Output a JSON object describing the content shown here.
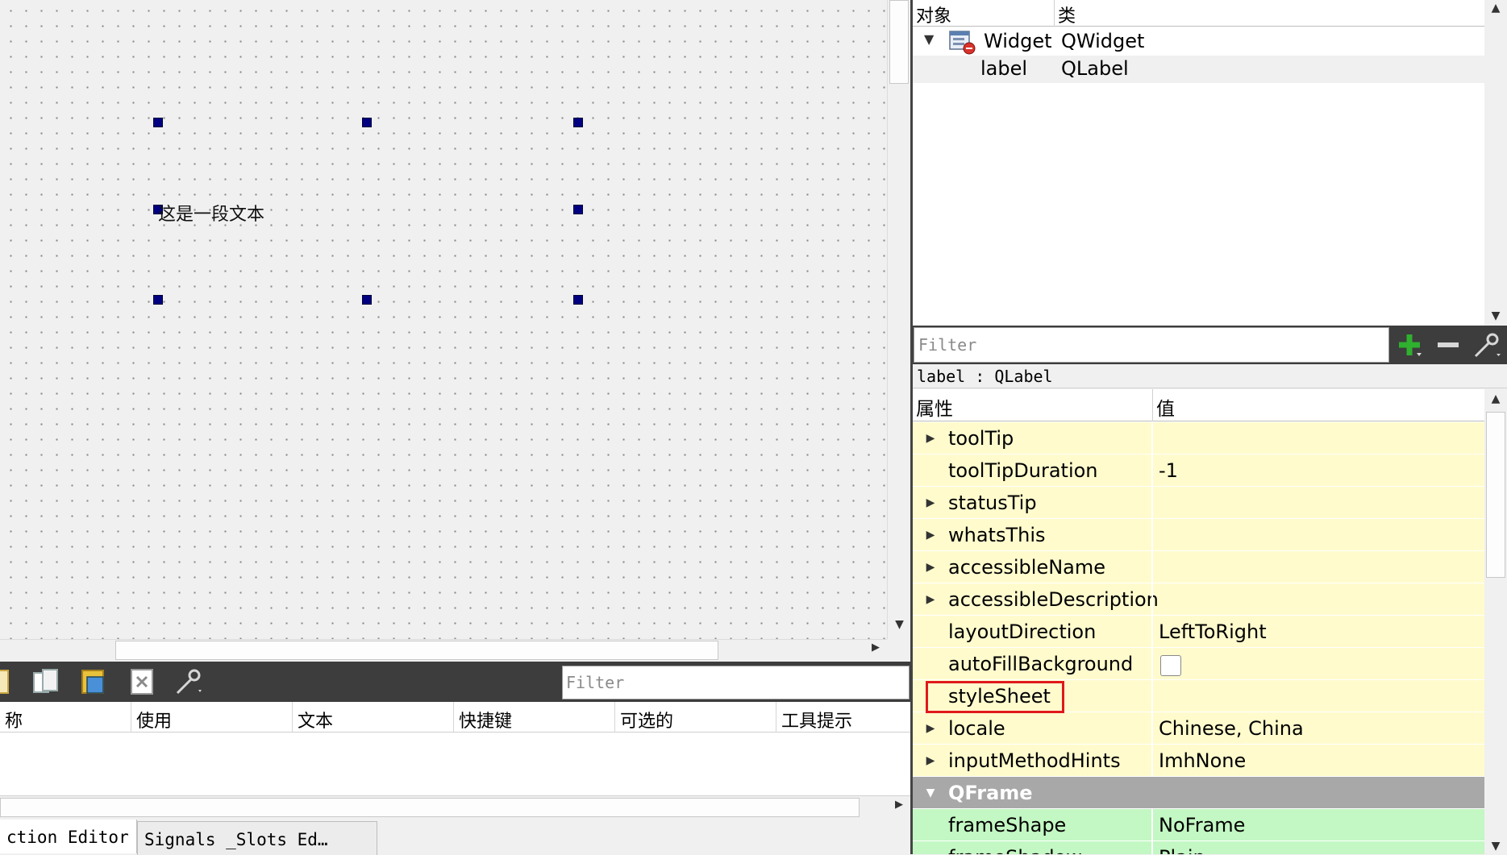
{
  "canvas": {
    "label_text": "这是一段文本"
  },
  "action_editor": {
    "filter_placeholder": "Filter",
    "columns": [
      "称",
      "使用",
      "文本",
      "快捷键",
      "可选的",
      "工具提示"
    ]
  },
  "bottom_tabs": {
    "action_editor": "ction Editor",
    "signals_slots": "Signals _Slots Ed…"
  },
  "object_inspector": {
    "headers": {
      "object": "对象",
      "class": "类"
    },
    "rows": [
      {
        "name": "Widget",
        "class": "QWidget",
        "icon": "widget-icon"
      },
      {
        "name": "label",
        "class": "QLabel"
      }
    ]
  },
  "property_editor": {
    "filter_placeholder": "Filter",
    "object_type": "label : QLabel",
    "headers": {
      "property": "属性",
      "value": "值"
    },
    "rows": [
      {
        "name": "toolTip",
        "value": "",
        "expandable": true
      },
      {
        "name": "toolTipDuration",
        "value": "-1",
        "expandable": false
      },
      {
        "name": "statusTip",
        "value": "",
        "expandable": true
      },
      {
        "name": "whatsThis",
        "value": "",
        "expandable": true
      },
      {
        "name": "accessibleName",
        "value": "",
        "expandable": true
      },
      {
        "name": "accessibleDescription",
        "value": "",
        "expandable": true
      },
      {
        "name": "layoutDirection",
        "value": "LeftToRight",
        "expandable": false
      },
      {
        "name": "autoFillBackground",
        "value": "",
        "expandable": false,
        "checkbox": true
      },
      {
        "name": "styleSheet",
        "value": "",
        "expandable": false,
        "highlighted": true
      },
      {
        "name": "locale",
        "value": "Chinese, China",
        "expandable": true
      },
      {
        "name": "inputMethodHints",
        "value": "ImhNone",
        "expandable": true
      },
      {
        "name": "QFrame",
        "value": "",
        "group": true
      },
      {
        "name": "frameShape",
        "value": "NoFrame",
        "expandable": false
      },
      {
        "name": "frameShadow",
        "value": "Plain",
        "expandable": false
      }
    ]
  },
  "colors": {
    "property_row": "#fffbcd",
    "group_row": "#a8a8a8",
    "frame_row": "#c3f7c3",
    "selection_handle": "#000080",
    "highlight_box": "#e0191b",
    "toolbar_bg": "#3d3d3d"
  }
}
